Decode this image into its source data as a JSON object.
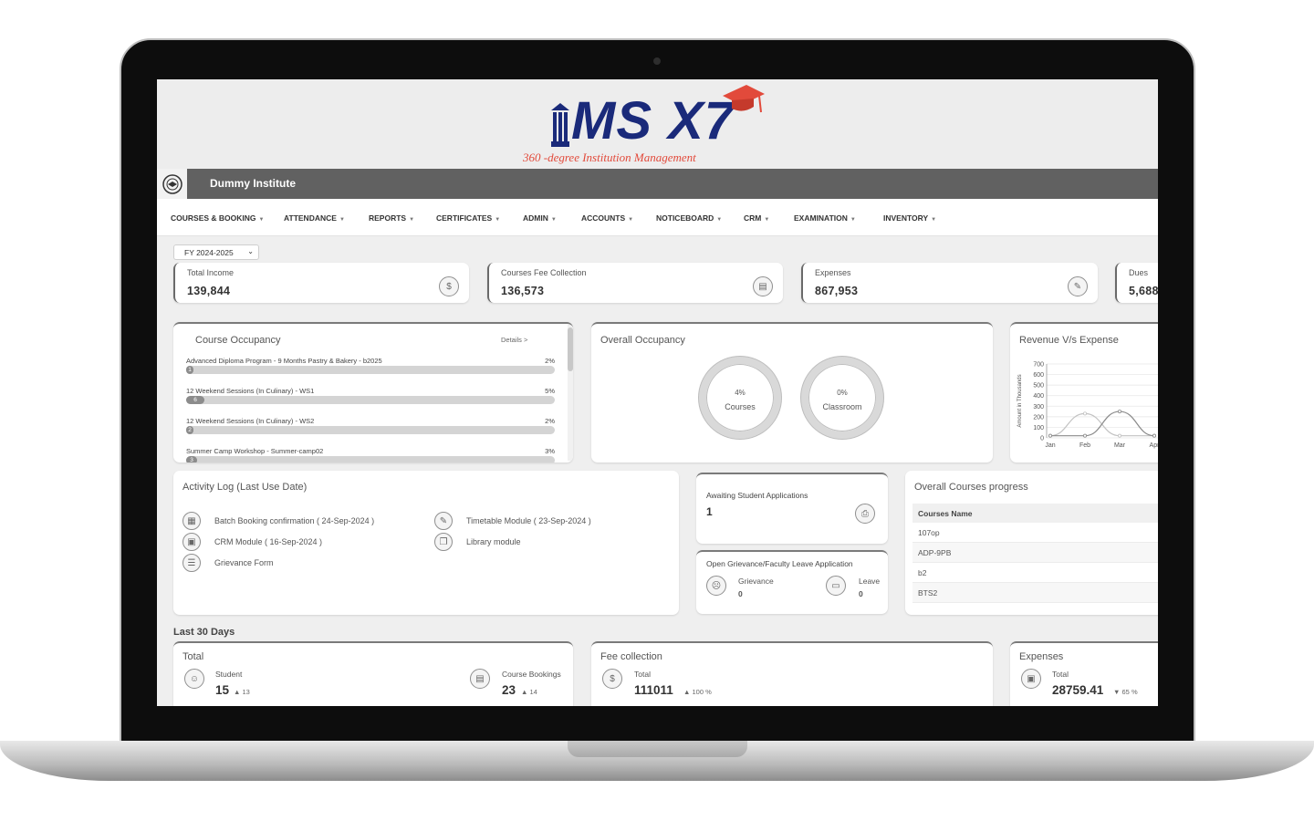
{
  "logo": {
    "text": "MS X7",
    "tagline": "360 -degree Institution Management"
  },
  "header": {
    "institute_name": "Dummy Institute"
  },
  "menu": [
    "COURSES & BOOKING",
    "ATTENDANCE",
    "REPORTS",
    "CERTIFICATES",
    "ADMIN",
    "ACCOUNTS",
    "NOTICEBOARD",
    "CRM",
    "EXAMINATION",
    "INVENTORY"
  ],
  "fiscal_year": "FY 2024-2025",
  "stats": [
    {
      "label": "Total Income",
      "value": "139,844"
    },
    {
      "label": "Courses Fee Collection",
      "value": "136,573"
    },
    {
      "label": "Expenses",
      "value": "867,953"
    },
    {
      "label": "Dues",
      "value": "5,688"
    }
  ],
  "course_occupancy": {
    "title": "Course Occupancy",
    "details_link": "Details >",
    "rows": [
      {
        "name": "Advanced Diploma Program - 9 Months Pastry & Bakery - b2025",
        "pct": "2%",
        "badge": "1",
        "fill": 0.02
      },
      {
        "name": "12 Weekend Sessions (In Culinary) - WS1",
        "pct": "5%",
        "badge": "6",
        "fill": 0.05
      },
      {
        "name": "12 Weekend Sessions (In Culinary) - WS2",
        "pct": "2%",
        "badge": "2",
        "fill": 0.02
      },
      {
        "name": "Summer Camp Workshop - Summer-camp02",
        "pct": "3%",
        "badge": "3",
        "fill": 0.03
      }
    ]
  },
  "overall_occupancy": {
    "title": "Overall Occupancy",
    "courses": {
      "pct": "4%",
      "name": "Courses"
    },
    "classroom": {
      "pct": "0%",
      "name": "Classroom"
    }
  },
  "revenue_chart": {
    "title": "Revenue V/s Expense",
    "ylabel": "Amount in Thousands",
    "yticks": [
      "700",
      "600",
      "500",
      "400",
      "300",
      "200",
      "100",
      "0"
    ],
    "xticks": [
      "Jan",
      "Feb",
      "Mar",
      "Apr"
    ]
  },
  "chart_data": {
    "type": "line",
    "title": "Revenue V/s Expense",
    "ylabel": "Amount in Thousands",
    "categories": [
      "Jan",
      "Feb",
      "Mar",
      "Apr"
    ],
    "ylim": [
      0,
      700
    ],
    "series": [
      {
        "values": [
          20,
          230,
          20,
          20
        ]
      },
      {
        "values": [
          20,
          20,
          250,
          20
        ]
      }
    ]
  },
  "activity_log": {
    "title": "Activity Log (Last Use Date)",
    "items": [
      "Batch Booking confirmation ( 24-Sep-2024 )",
      "CRM Module ( 16-Sep-2024 )",
      "Grievance Form",
      "Timetable Module ( 23-Sep-2024 )",
      "Library module"
    ]
  },
  "awaiting": {
    "title": "Awaiting Student Applications",
    "value": "1"
  },
  "grievance": {
    "title": "Open Grievance/Faculty Leave Application",
    "grievance_label": "Grievance",
    "grievance_value": "0",
    "leave_label": "Leave",
    "leave_value": "0"
  },
  "courses_progress": {
    "title": "Overall Courses progress",
    "header": "Courses Name",
    "rows": [
      "107op",
      "ADP-9PB",
      "b2",
      "BTS2"
    ]
  },
  "last30": {
    "label": "Last 30 Days",
    "total": {
      "title": "Total",
      "student_label": "Student",
      "student_value": "15",
      "student_delta": "13",
      "bookings_label": "Course Bookings",
      "bookings_value": "23",
      "bookings_delta": "14"
    },
    "fee": {
      "title": "Fee collection",
      "label": "Total",
      "value": "111011",
      "delta": "100 %"
    },
    "expenses": {
      "title": "Expenses",
      "label": "Total",
      "value": "28759.41",
      "delta": "65 %"
    }
  }
}
